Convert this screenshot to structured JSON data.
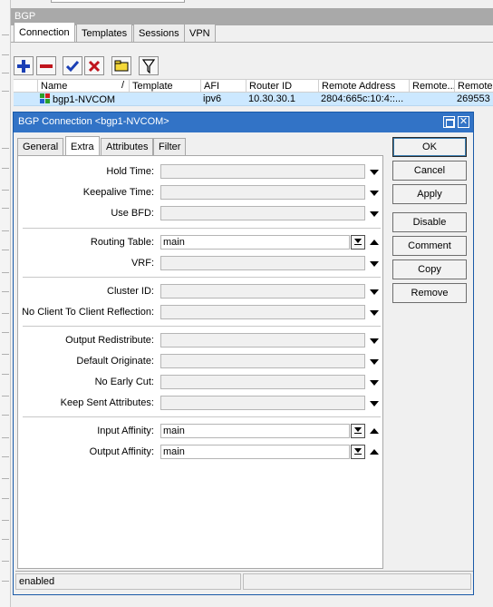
{
  "bgp_window": {
    "title": "BGP"
  },
  "tabs": [
    "Connection",
    "Templates",
    "Sessions",
    "VPN"
  ],
  "toolbar": {
    "icons": [
      "add-icon",
      "remove-icon",
      "enable-icon",
      "disable-icon",
      "comment-icon",
      "filter-icon"
    ],
    "colors": {
      "add": "#1a3fb5",
      "remove": "#c0141c",
      "enable": "#1a3fb5",
      "disable": "#c0141c",
      "comment": "#f4d83a",
      "filter": "#ffffff"
    }
  },
  "table": {
    "columns": [
      "Name",
      "Template",
      "AFI",
      "Router ID",
      "Remote Address",
      "Remote...",
      "Remote"
    ],
    "rows": [
      {
        "name": "bgp1-NVCOM",
        "template": "",
        "afi": "ipv6",
        "router_id": "10.30.30.1",
        "remote_address": "2804:665c:10:4::...",
        "remote_as": "",
        "remote": "269553"
      }
    ]
  },
  "dialog": {
    "title": "BGP Connection <bgp1-NVCOM>",
    "tabs": [
      "General",
      "Extra",
      "Attributes",
      "Filter"
    ],
    "active_tab": "Extra",
    "fields": {
      "hold_time": {
        "label": "Hold Time:",
        "value": ""
      },
      "keepalive_time": {
        "label": "Keepalive Time:",
        "value": ""
      },
      "use_bfd": {
        "label": "Use BFD:",
        "value": ""
      },
      "routing_table": {
        "label": "Routing Table:",
        "value": "main"
      },
      "vrf": {
        "label": "VRF:",
        "value": ""
      },
      "cluster_id": {
        "label": "Cluster ID:",
        "value": ""
      },
      "no_client_to_client_reflection": {
        "label": "No Client To Client Reflection:",
        "value": ""
      },
      "output_redistribute": {
        "label": "Output Redistribute:",
        "value": ""
      },
      "default_originate": {
        "label": "Default Originate:",
        "value": ""
      },
      "no_early_cut": {
        "label": "No Early Cut:",
        "value": ""
      },
      "keep_sent_attributes": {
        "label": "Keep Sent Attributes:",
        "value": ""
      },
      "input_affinity": {
        "label": "Input Affinity:",
        "value": "main"
      },
      "output_affinity": {
        "label": "Output Affinity:",
        "value": "main"
      }
    },
    "buttons": {
      "ok": "OK",
      "cancel": "Cancel",
      "apply": "Apply",
      "disable": "Disable",
      "comment": "Comment",
      "copy": "Copy",
      "remove": "Remove"
    },
    "status": "enabled"
  }
}
